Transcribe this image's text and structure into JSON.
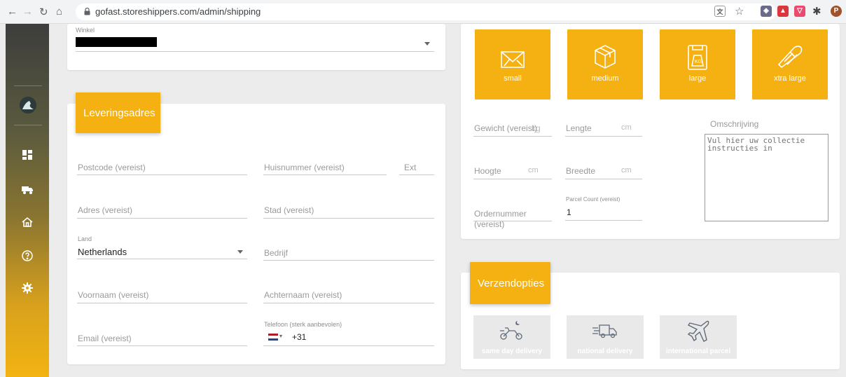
{
  "browser": {
    "url": "gofast.storeshippers.com/admin/shipping",
    "profile_initial": "P"
  },
  "store": {
    "label": "Winkel"
  },
  "address": {
    "title": "Leveringsadres",
    "postcode_placeholder": "Postcode (vereist)",
    "huisnummer_placeholder": "Huisnummer (vereist)",
    "ext_placeholder": "Ext",
    "adres_placeholder": "Adres (vereist)",
    "stad_placeholder": "Stad (vereist)",
    "land_label": "Land",
    "land_value": "Netherlands",
    "bedrijf_placeholder": "Bedrijf",
    "voornaam_placeholder": "Voornaam (vereist)",
    "achternaam_placeholder": "Achternaam (vereist)",
    "email_placeholder": "Email (vereist)",
    "telefoon_label": "Telefoon (sterk aanbevolen)",
    "telefoon_value": "+31"
  },
  "package": {
    "sizes": [
      {
        "label": "small",
        "icon": "small-package-icon"
      },
      {
        "label": "medium",
        "icon": "medium-box-icon"
      },
      {
        "label": "large",
        "icon": "large-weight-icon"
      },
      {
        "label": "xtra large",
        "icon": "xtra-large-package-icon"
      }
    ],
    "gewicht_placeholder": "Gewicht (vereist)",
    "gewicht_unit": "kg",
    "lengte_placeholder": "Lengte",
    "lengte_unit": "cm",
    "hoogte_placeholder": "Hoogte",
    "hoogte_unit": "cm",
    "breedte_placeholder": "Breedte",
    "breedte_unit": "cm",
    "ordernummer_placeholder_1": "Ordernummer",
    "ordernummer_placeholder_2": "(vereist)",
    "parcel_count_label": "Parcel Count (vereist)",
    "parcel_count_value": "1",
    "omschrijving_label": "Omschrijving",
    "omschrijving_placeholder": "Vul hier uw collectie instructies in"
  },
  "shipping": {
    "title": "Verzendopties",
    "options": [
      {
        "label": "same day delivery",
        "icon": "bike-moon-icon"
      },
      {
        "label": "national delivery",
        "icon": "truck-icon"
      },
      {
        "label": "international parcel",
        "icon": "airplane-icon"
      }
    ]
  },
  "colors": {
    "accent": "#f5b012",
    "sidebar_top": "#3d3d3d",
    "sidebar_bottom": "#f2b312"
  }
}
